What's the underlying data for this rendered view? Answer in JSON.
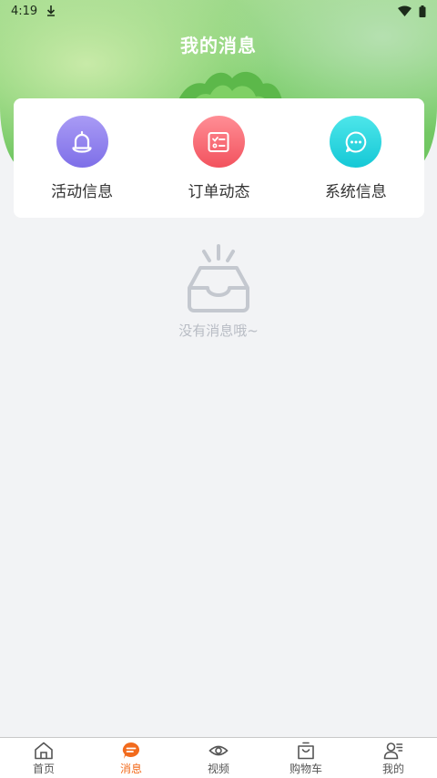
{
  "status_bar": {
    "time": "4:19"
  },
  "header": {
    "title": "我的消息"
  },
  "categories": [
    {
      "label": "活动信息",
      "icon": "bell-icon",
      "color_from": "#a99bf5",
      "color_to": "#7e6fe8"
    },
    {
      "label": "订单动态",
      "icon": "order-list-icon",
      "color_from": "#ff8e95",
      "color_to": "#f2525e"
    },
    {
      "label": "系统信息",
      "icon": "chat-bubble-icon",
      "color_from": "#4ee6ea",
      "color_to": "#15c8d6"
    }
  ],
  "empty_state": {
    "text": "没有消息哦~"
  },
  "tabbar": {
    "active_color": "#f26b1d",
    "items": [
      {
        "label": "首页",
        "icon": "home-icon"
      },
      {
        "label": "消息",
        "icon": "message-icon",
        "active": true
      },
      {
        "label": "视频",
        "icon": "eye-icon"
      },
      {
        "label": "购物车",
        "icon": "shopping-bag-icon"
      },
      {
        "label": "我的",
        "icon": "profile-icon"
      }
    ]
  }
}
